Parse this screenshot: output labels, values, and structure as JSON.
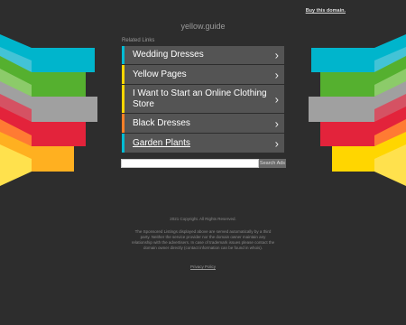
{
  "header": {
    "buy_link": "Buy this domain.",
    "domain": "yellow.guide"
  },
  "related": {
    "title": "Related Links",
    "items": [
      {
        "label": "Wedding Dresses",
        "accent": "#00bcd4"
      },
      {
        "label": "Yellow Pages",
        "accent": "#ffd600"
      },
      {
        "label": "I Want to Start an Online Clothing Store",
        "accent": "#ffd600"
      },
      {
        "label": "Black Dresses",
        "accent": "#ff7f27"
      },
      {
        "label": "Garden Plants",
        "accent": "#00bcd4"
      }
    ]
  },
  "search": {
    "value": "",
    "button": "Search Ads"
  },
  "footer": {
    "copyright": "2021 Copyright. All Rights Reserved.",
    "disclaimer": "The Sponsored Listings displayed above are served automatically by a third party. Neither the service provider nor the domain owner maintain any relationship with the advertisers. In case of trademark issues please contact the domain owner directly (contact information can be found in whois).",
    "privacy": "Privacy Policy"
  },
  "colors": {
    "background": "#2d2d2d",
    "stripes": [
      "#00b5cc",
      "#35c6d8",
      "#55b02f",
      "#8fcc6a",
      "#9a9a9a",
      "#d94b5a",
      "#e3233b",
      "#ff6a2a",
      "#ffb020",
      "#ffe14d"
    ]
  }
}
